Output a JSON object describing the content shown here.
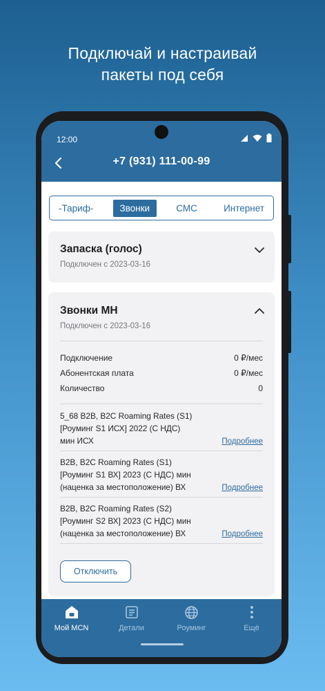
{
  "promo": {
    "line1": "Подключай и настраивай",
    "line2": "пакеты под себя"
  },
  "status_bar": {
    "time": "12:00"
  },
  "app_bar": {
    "title": "+7 (931) 111-00-99"
  },
  "tabs": [
    {
      "label": "-Тариф-",
      "active": false
    },
    {
      "label": "Звонки",
      "active": true
    },
    {
      "label": "СМС",
      "active": false
    },
    {
      "label": "Интернет",
      "active": false
    }
  ],
  "cards": {
    "first": {
      "title": "Запаска (голос)",
      "subtitle": "Подключен с 2023-03-16",
      "expanded": false
    },
    "second": {
      "title": "Звонки МН",
      "subtitle": "Подключен с 2023-03-16",
      "expanded": true,
      "details": [
        {
          "label": "Подключение",
          "value": "0 ₽/мес"
        },
        {
          "label": "Абонентская плата",
          "value": "0 ₽/мес"
        },
        {
          "label": "Количество",
          "value": "0"
        }
      ],
      "packages": [
        {
          "lines": [
            "5_68 B2B, B2C Roaming Rates (S1)",
            "[Роуминг S1 ИСХ] 2022 (С НДС)",
            "мин ИСХ"
          ],
          "link": "Подробнее"
        },
        {
          "lines": [
            "B2B, B2C Roaming Rates (S1)",
            "[Роуминг S1 ВХ] 2023 (С НДС) мин",
            "(наценка за местоположение) ВХ"
          ],
          "link": "Подробнее"
        },
        {
          "lines": [
            "B2B, B2C Roaming Rates (S2)",
            "[Роуминг S2 ВХ] 2023 (С НДС) мин",
            "(наценка за местоположение) ВХ"
          ],
          "link": "Подробнее"
        }
      ],
      "button_label": "Отключить"
    }
  },
  "bottom_nav": [
    {
      "label": "Мой MCN",
      "icon": "home-icon",
      "active": true
    },
    {
      "label": "Детали",
      "icon": "details-icon",
      "active": false
    },
    {
      "label": "Роуминг",
      "icon": "globe-icon",
      "active": false
    },
    {
      "label": "Ещё",
      "icon": "more-vertical-icon",
      "active": false
    }
  ],
  "colors": {
    "brand": "#2c6c9f",
    "card_background": "#f2f1f3"
  }
}
